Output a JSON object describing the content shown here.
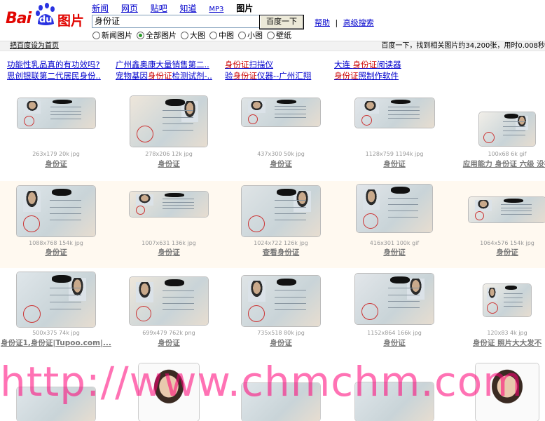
{
  "logo": {
    "text_left": "Bai",
    "text_mid": "du",
    "text_right": "图片"
  },
  "nav": {
    "items": [
      "新闻",
      "网页",
      "贴吧",
      "知道",
      "MP3"
    ],
    "current": "图片"
  },
  "search": {
    "value": "身份证",
    "button": "百度一下",
    "help": "帮助",
    "advanced": "高级搜索"
  },
  "radios": [
    {
      "label": "新闻图片",
      "checked": false
    },
    {
      "label": "全部图片",
      "checked": true
    },
    {
      "label": "大图",
      "checked": false
    },
    {
      "label": "中图",
      "checked": false
    },
    {
      "label": "小图",
      "checked": false
    },
    {
      "label": "壁纸",
      "checked": false
    }
  ],
  "bar": {
    "left": "把百度设为首页",
    "right": "百度一下，找到相关图片约34,200张，用时0.008秒"
  },
  "ads": {
    "col1": [
      "功能性乳品真的有功效吗?",
      "思创银联第二代居民身份.."
    ],
    "col2": [
      "广州鑫奥康大量销售第二..",
      "宠物基因身份证检测试剂-.."
    ],
    "col3": [
      "身份证扫描仪",
      "验身份证仪器--广州汇翔"
    ],
    "col4": [
      "大连 身份证阅读器",
      "身份证照制作软件"
    ]
  },
  "results": [
    {
      "meta": "263x179 20k jpg",
      "caption": "身份证"
    },
    {
      "meta": "278x206 12k jpg",
      "caption": "身份证"
    },
    {
      "meta": "437x300 50k jpg",
      "caption": "身份证"
    },
    {
      "meta": "1128x759 1194k jpg",
      "caption": "身份证"
    },
    {
      "meta": "100x68 6k gif",
      "caption": "应用能力 身份证 六级 没有"
    },
    {
      "meta": "1088x768 154k jpg",
      "caption": "身份证"
    },
    {
      "meta": "1007x631 136k jpg",
      "caption": "身份证"
    },
    {
      "meta": "1024x722 126k jpg",
      "caption": "查看身份证"
    },
    {
      "meta": "416x301 100k gif",
      "caption": "身份证"
    },
    {
      "meta": "1064x576 154k jpg",
      "caption": "身份证"
    },
    {
      "meta": "500x375 74k jpg",
      "caption": "身份证1,身份证|Tupoo.com|..."
    },
    {
      "meta": "699x479 762k png",
      "caption": "身份证"
    },
    {
      "meta": "735x518 80k jpg",
      "caption": "身份证"
    },
    {
      "meta": "1152x864 166k jpg",
      "caption": "身份证"
    },
    {
      "meta": "120x83 4k jpg",
      "caption": "身份证 照片大大发不"
    }
  ],
  "watermark": "http://www.chmchm.com"
}
